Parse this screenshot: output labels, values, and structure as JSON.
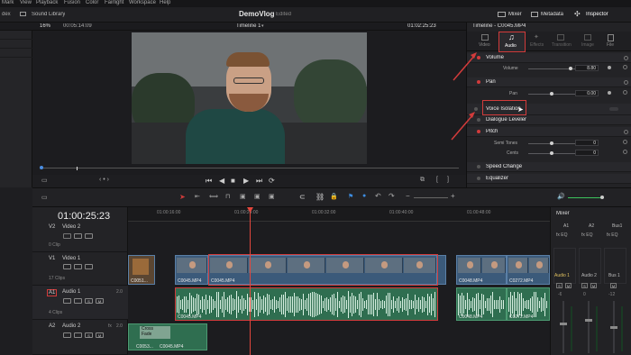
{
  "menu": [
    "Mark",
    "View",
    "Playback",
    "Fusion",
    "Color",
    "Fairlight",
    "Workspace",
    "Help"
  ],
  "toolbar": {
    "left_item": "dex",
    "sound_library": "Sound Library",
    "project_name": "DemoVlog",
    "project_status": "Edited",
    "mixer": "Mixer",
    "metadata": "Metadata",
    "inspector": "Inspector"
  },
  "viewer": {
    "zoom": "16%",
    "source_timecode": "00:05:14:09",
    "timeline_name": "Timeline 1",
    "timecode": "01:02:25:23"
  },
  "inspector": {
    "title": "Timeline - C0045.MP4",
    "tabs": [
      "Video",
      "Audio",
      "Effects",
      "Transition",
      "Image",
      "File"
    ],
    "volume_section": "Volume",
    "volume_label": "Volume",
    "volume_value": "8.80",
    "pan_section": "Pan",
    "pan_label": "Pan",
    "pan_value": "0.00",
    "voice_isolation": "Voice Isolation",
    "dialogue_leveler": "Dialogue Leveler",
    "pitch_section": "Pitch",
    "semitones_label": "Semi Tones",
    "semitones_value": "0",
    "cents_label": "Cents",
    "cents_value": "0",
    "speed_change": "Speed Change",
    "equalizer": "Equalizer"
  },
  "left_panel": {
    "item1": "ion"
  },
  "timeline": {
    "timecode": "01:00:25:23",
    "ruler": [
      "01:00:16:00",
      "01:00:24:00",
      "01:00:32:00",
      "01:00:40:00",
      "01:00:48:00"
    ],
    "tracks": [
      {
        "id": "V2",
        "name": "Video 2",
        "clips": "0 Clip"
      },
      {
        "id": "V1",
        "name": "Video 1",
        "clips": "17 Clips"
      },
      {
        "id": "A1",
        "name": "Audio 1",
        "level": "2.0",
        "clips": "4 Clips"
      },
      {
        "id": "A2",
        "name": "Audio 2",
        "level": "2.0",
        "fx": "fx"
      }
    ],
    "clip_labels": {
      "v1a": "C0051...",
      "v1b": "C0045.MP4",
      "v1c": "C0045.MP4",
      "v1d": "C0048.MP4",
      "v1e": "C0272.MP4",
      "a1a": "C0045.MP4",
      "a1b": "C0048.MP4",
      "a1c": "C0272.MP4",
      "a2a": "C0053...",
      "a2b": "C0045.MP4",
      "a2_cross": "Cross",
      "a2_fade": "Fade"
    }
  },
  "mixer": {
    "title": "Mixer",
    "channels": [
      "A1",
      "A2",
      "Bus1"
    ],
    "strip_labels": [
      "Audio 1",
      "Audio 2",
      "Bus 1"
    ],
    "meter_values": [
      "-6",
      "0",
      "-12"
    ]
  },
  "colors": {
    "accent_red": "#d23b3b",
    "audio_clip": "#2f6e50",
    "video_clip": "#3b5a7a",
    "playhead": "#e2473d"
  }
}
